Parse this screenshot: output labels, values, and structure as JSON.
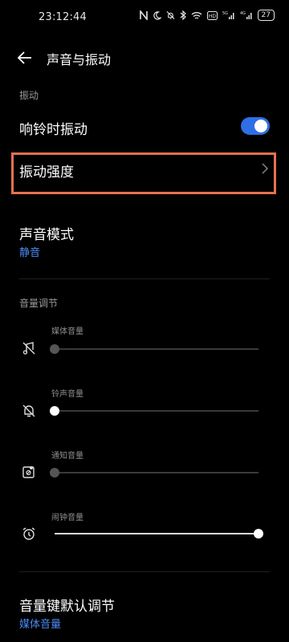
{
  "status_bar": {
    "time": "23:12:44",
    "battery": "27",
    "icons": [
      "nfc-icon",
      "moon-icon",
      "bell-off-icon",
      "bluetooth-icon",
      "wifi-icon",
      "hd-icon",
      "signal-5g-icon",
      "signal-4g-icon",
      "battery-icon"
    ]
  },
  "header": {
    "title": "声音与振动",
    "back_icon": "back-arrow-icon"
  },
  "vibration": {
    "section_label": "振动",
    "ring_vibrate_label": "响铃时振动",
    "ring_vibrate_on": true,
    "intensity_label": "振动强度"
  },
  "sound_mode": {
    "label": "声音模式",
    "value": "静音"
  },
  "volume": {
    "section_label": "音量调节",
    "sliders": [
      {
        "label": "媒体音量",
        "icon": "music-off-icon",
        "level": 0
      },
      {
        "label": "铃声音量",
        "icon": "bell-off-icon",
        "level": 0
      },
      {
        "label": "通知音量",
        "icon": "notification-off-icon",
        "level": 0
      },
      {
        "label": "闹钟音量",
        "icon": "alarm-clock-icon",
        "level": 1
      }
    ]
  },
  "volume_key": {
    "label": "音量键默认调节",
    "value": "媒体音量"
  },
  "colors": {
    "accent": "#4c8bf5",
    "toggle_on": "#2f6fe4",
    "highlight": "#e8704f"
  }
}
